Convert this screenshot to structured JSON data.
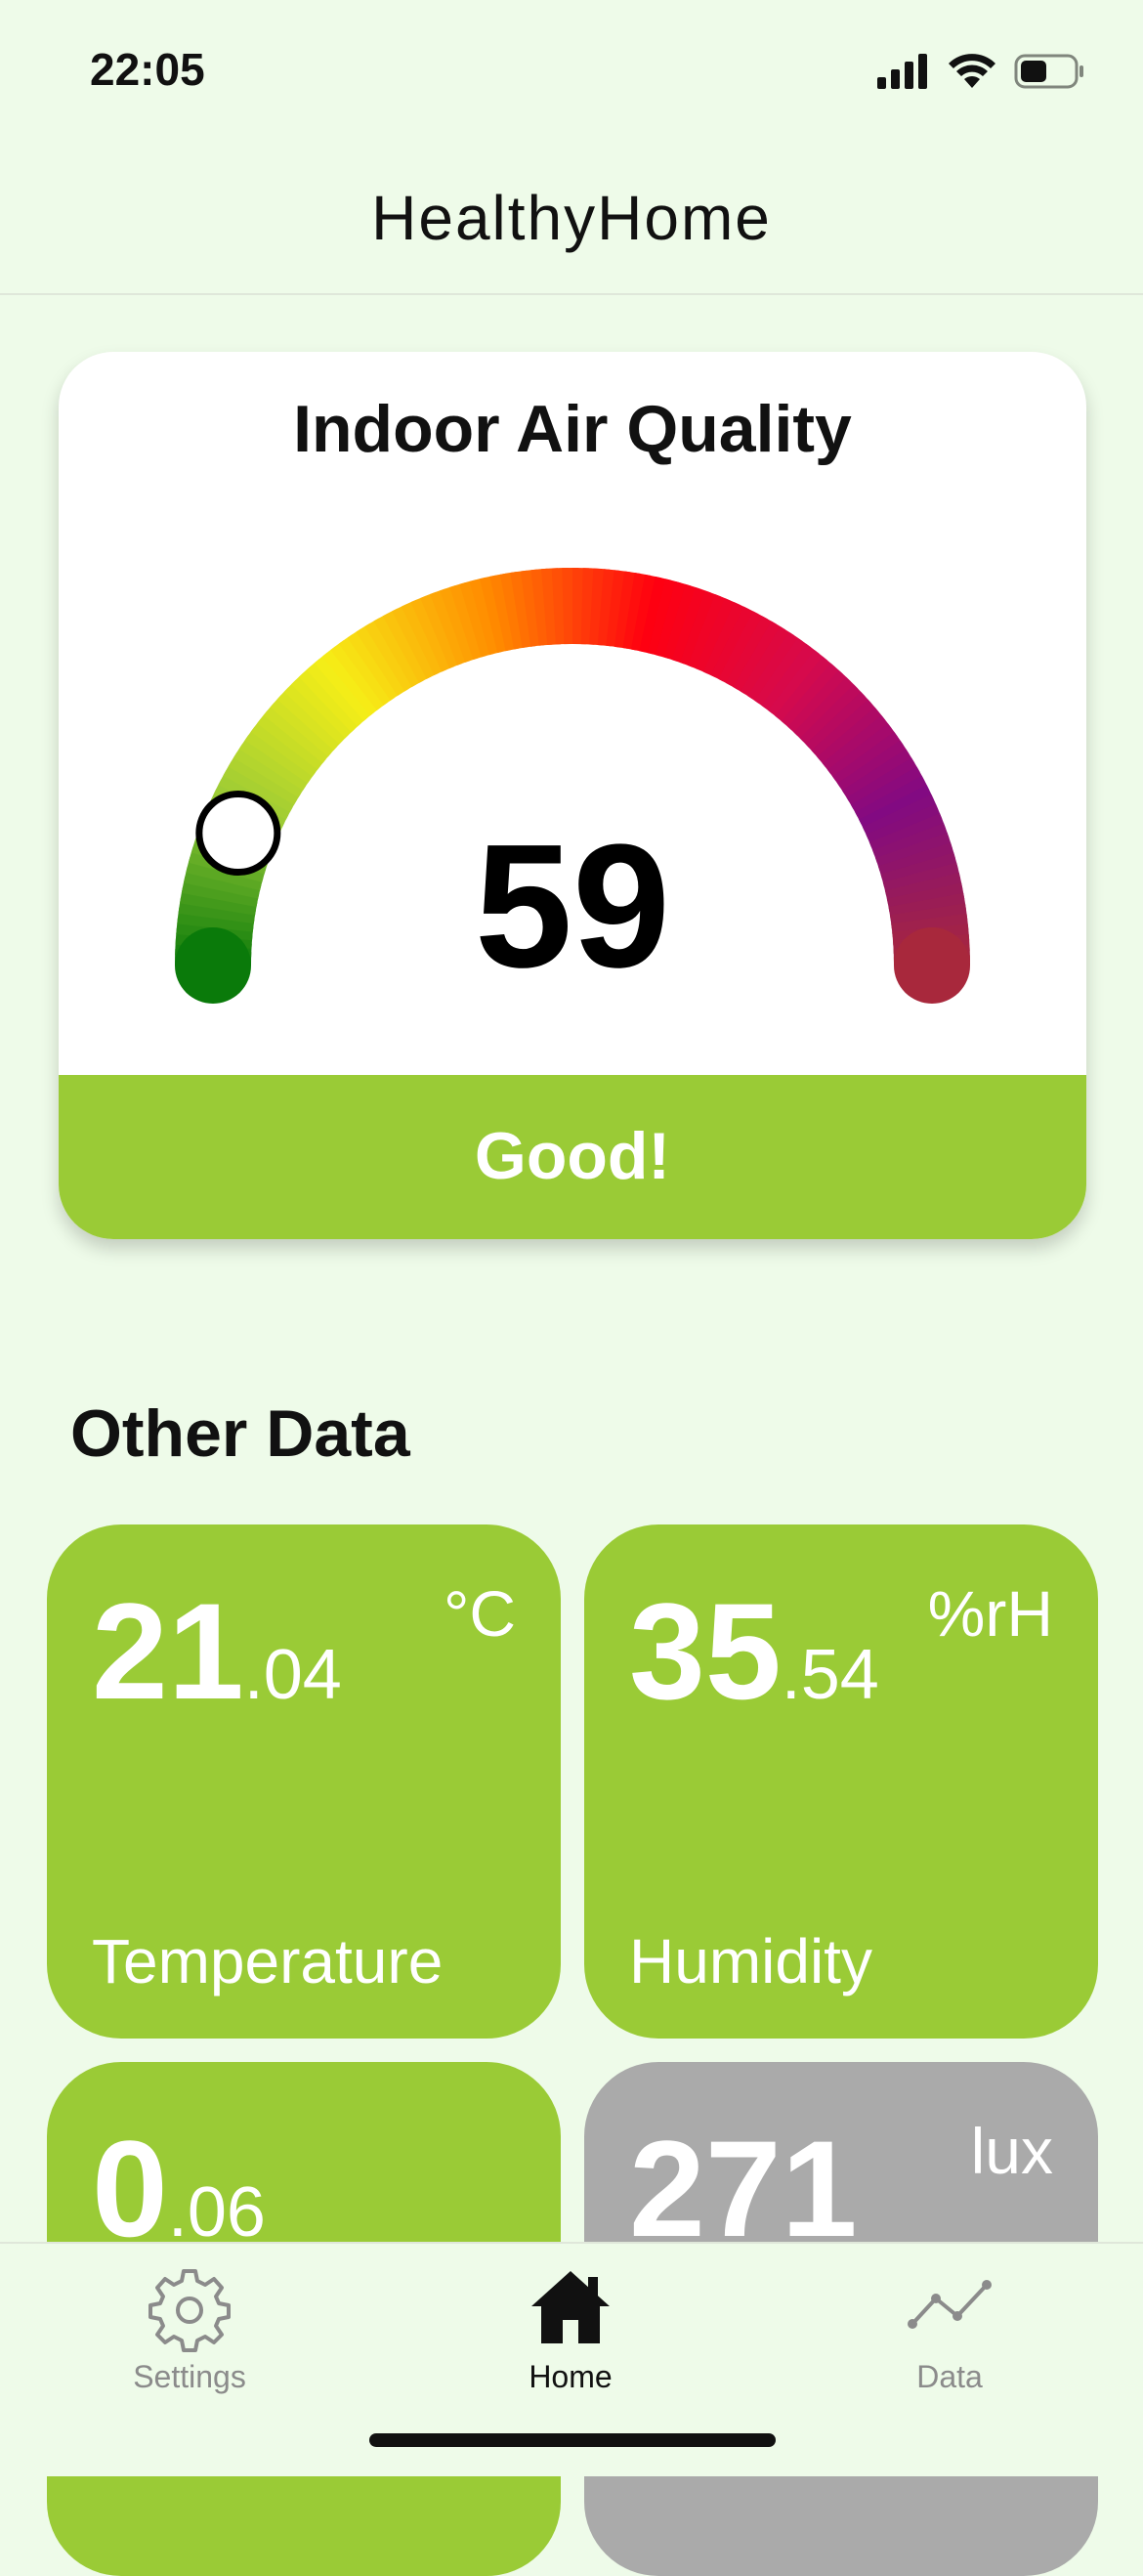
{
  "status_bar": {
    "time": "22:05",
    "icons": [
      "cellular-signal-icon",
      "wifi-icon",
      "battery-icon"
    ]
  },
  "header": {
    "title": "HealthyHome"
  },
  "air_quality": {
    "title": "Indoor Air Quality",
    "value": "59",
    "status": "Good!",
    "gauge_level_fraction": 0.12,
    "gauge_colors": [
      "#0a7a0a",
      "#9acb36",
      "#f6ee17",
      "#ff8c00",
      "#ff0010",
      "#d60a4c",
      "#820a82",
      "#a8283c"
    ],
    "status_color": "#9acb36"
  },
  "other_data": {
    "title": "Other Data",
    "tiles": [
      {
        "int": "21",
        "dec": ".04",
        "unit": "°C",
        "label": "Temperature"
      },
      {
        "int": "35",
        "dec": ".54",
        "unit": "%rH",
        "label": "Humidity"
      },
      {
        "int": "0",
        "dec": ".06",
        "unit": "",
        "label": ""
      },
      {
        "int": "271",
        "dec": "",
        "unit": "lux",
        "label": ""
      }
    ],
    "tile_color_good": "#9acb36",
    "tile_color_neutral": "#aaaaaa"
  },
  "tab_bar": {
    "tabs": [
      {
        "label": "Settings",
        "icon": "gear-icon",
        "active": false
      },
      {
        "label": "Home",
        "icon": "home-icon",
        "active": true
      },
      {
        "label": "Data",
        "icon": "line-chart-icon",
        "active": false
      }
    ]
  }
}
